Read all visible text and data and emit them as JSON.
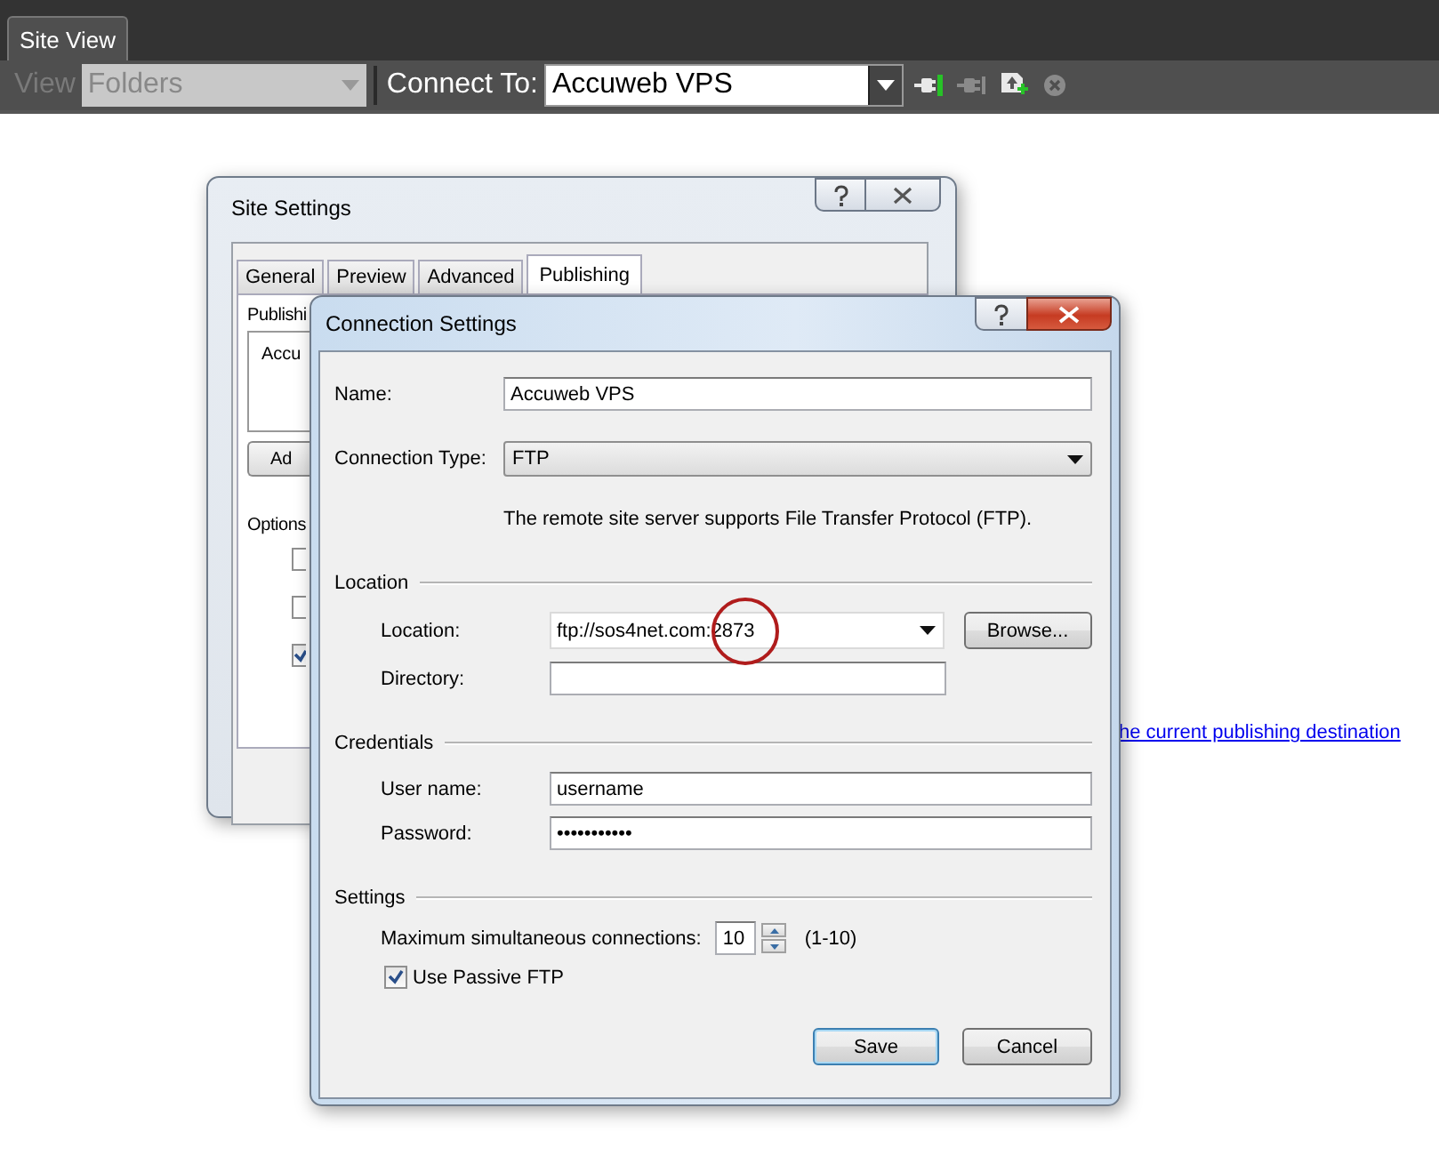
{
  "tab": {
    "label": "Site View",
    "selected": true
  },
  "toolbar": {
    "view_label": "View",
    "view_value": "Folders",
    "view_disabled": true,
    "connect_label": "Connect To:",
    "connect_value": "Accuweb VPS",
    "buttons": [
      {
        "kind": "connect",
        "disabled": false
      },
      {
        "kind": "disconnect",
        "disabled": true
      },
      {
        "kind": "upload",
        "disabled": false
      },
      {
        "kind": "stop",
        "disabled": true
      }
    ]
  },
  "background_link": "he current publishing destination",
  "site_settings": {
    "title": "Site Settings",
    "tabs": [
      {
        "label": "General",
        "selected": false
      },
      {
        "label": "Preview",
        "selected": false
      },
      {
        "label": "Advanced",
        "selected": false
      },
      {
        "label": "Publishing",
        "selected": true
      }
    ],
    "publishing_label": "Publishi",
    "list_item": "Accu",
    "add_button": "Ad",
    "options_label": "Options",
    "checkboxes": [
      {
        "checked": false
      },
      {
        "checked": false
      },
      {
        "checked": true
      }
    ]
  },
  "connection_settings": {
    "title": "Connection Settings",
    "name_label": "Name:",
    "name_value": "Accuweb VPS",
    "type_label": "Connection Type:",
    "type_value": "FTP",
    "type_description": "The remote site server supports File Transfer Protocol (FTP).",
    "location_group": "Location",
    "location_label": "Location:",
    "location_value": "ftp://sos4net.com:2873",
    "browse_button": "Browse...",
    "directory_label": "Directory:",
    "credentials_group": "Credentials",
    "username_label": "User name:",
    "username_value": "username",
    "password_label": "Password:",
    "password_value": "•••••••••••",
    "settings_group": "Settings",
    "max_label": "Maximum simultaneous connections:",
    "max_value": "10",
    "max_range": "(1-10)",
    "passive": {
      "label": "Use Passive FTP",
      "checked": true
    },
    "save_button": "Save",
    "cancel_button": "Cancel"
  }
}
